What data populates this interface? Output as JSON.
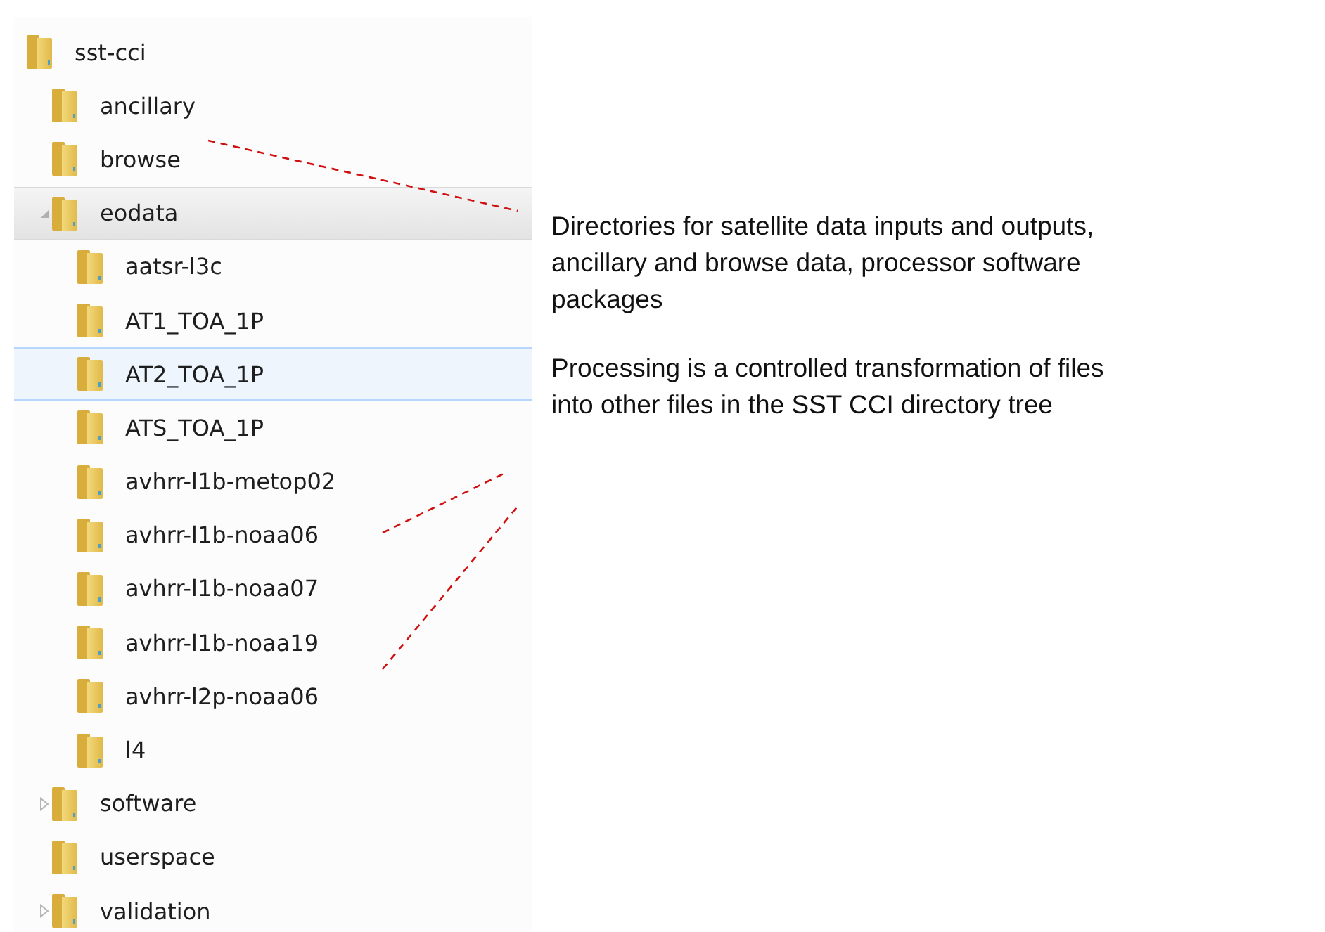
{
  "tree": [
    {
      "label": "sst-cci",
      "selected": false,
      "hovered": false,
      "children": [
        {
          "label": "ancillary",
          "selected": false,
          "hovered": false
        },
        {
          "label": "browse",
          "selected": false,
          "hovered": false
        },
        {
          "label": "eodata",
          "kind": "expanded",
          "selected": true,
          "hovered": false,
          "children": [
            {
              "label": "aatsr-l3c",
              "selected": false,
              "hovered": false
            },
            {
              "label": "AT1_TOA_1P",
              "selected": false,
              "hovered": false
            },
            {
              "label": "AT2_TOA_1P",
              "selected": false,
              "hovered": true
            },
            {
              "label": "ATS_TOA_1P",
              "selected": false,
              "hovered": false
            },
            {
              "label": "avhrr-l1b-metop02",
              "selected": false,
              "hovered": false
            },
            {
              "label": "avhrr-l1b-noaa06",
              "selected": false,
              "hovered": false
            },
            {
              "label": "avhrr-l1b-noaa07",
              "selected": false,
              "hovered": false
            },
            {
              "label": "avhrr-l1b-noaa19",
              "selected": false,
              "hovered": false
            },
            {
              "label": "avhrr-l2p-noaa06",
              "selected": false,
              "hovered": false
            },
            {
              "label": "l4",
              "selected": false,
              "hovered": false
            }
          ]
        },
        {
          "label": "software",
          "kind": "collapsed",
          "selected": false,
          "hovered": false
        },
        {
          "label": "userspace",
          "selected": false,
          "hovered": false
        },
        {
          "label": "validation",
          "kind": "collapsed",
          "selected": false,
          "hovered": false
        }
      ]
    }
  ],
  "notes": [
    {
      "lines": [
        "Directories for satellite data inputs and outputs,",
        "ancillary and browse data, processor software",
        "packages"
      ]
    },
    {
      "lines": [
        "Processing is a controlled transformation of files",
        "into other files in the SST CCI directory tree"
      ]
    }
  ]
}
